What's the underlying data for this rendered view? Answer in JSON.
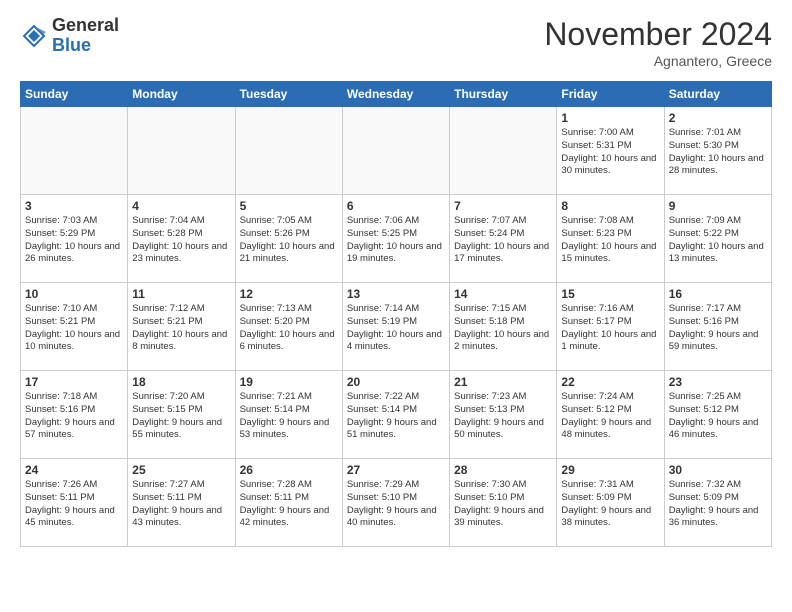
{
  "header": {
    "logo_line1": "General",
    "logo_line2": "Blue",
    "month": "November 2024",
    "location": "Agnantero, Greece"
  },
  "weekdays": [
    "Sunday",
    "Monday",
    "Tuesday",
    "Wednesday",
    "Thursday",
    "Friday",
    "Saturday"
  ],
  "weeks": [
    [
      {
        "day": "",
        "detail": ""
      },
      {
        "day": "",
        "detail": ""
      },
      {
        "day": "",
        "detail": ""
      },
      {
        "day": "",
        "detail": ""
      },
      {
        "day": "",
        "detail": ""
      },
      {
        "day": "1",
        "detail": "Sunrise: 7:00 AM\nSunset: 5:31 PM\nDaylight: 10 hours\nand 30 minutes."
      },
      {
        "day": "2",
        "detail": "Sunrise: 7:01 AM\nSunset: 5:30 PM\nDaylight: 10 hours\nand 28 minutes."
      }
    ],
    [
      {
        "day": "3",
        "detail": "Sunrise: 7:03 AM\nSunset: 5:29 PM\nDaylight: 10 hours\nand 26 minutes."
      },
      {
        "day": "4",
        "detail": "Sunrise: 7:04 AM\nSunset: 5:28 PM\nDaylight: 10 hours\nand 23 minutes."
      },
      {
        "day": "5",
        "detail": "Sunrise: 7:05 AM\nSunset: 5:26 PM\nDaylight: 10 hours\nand 21 minutes."
      },
      {
        "day": "6",
        "detail": "Sunrise: 7:06 AM\nSunset: 5:25 PM\nDaylight: 10 hours\nand 19 minutes."
      },
      {
        "day": "7",
        "detail": "Sunrise: 7:07 AM\nSunset: 5:24 PM\nDaylight: 10 hours\nand 17 minutes."
      },
      {
        "day": "8",
        "detail": "Sunrise: 7:08 AM\nSunset: 5:23 PM\nDaylight: 10 hours\nand 15 minutes."
      },
      {
        "day": "9",
        "detail": "Sunrise: 7:09 AM\nSunset: 5:22 PM\nDaylight: 10 hours\nand 13 minutes."
      }
    ],
    [
      {
        "day": "10",
        "detail": "Sunrise: 7:10 AM\nSunset: 5:21 PM\nDaylight: 10 hours\nand 10 minutes."
      },
      {
        "day": "11",
        "detail": "Sunrise: 7:12 AM\nSunset: 5:21 PM\nDaylight: 10 hours\nand 8 minutes."
      },
      {
        "day": "12",
        "detail": "Sunrise: 7:13 AM\nSunset: 5:20 PM\nDaylight: 10 hours\nand 6 minutes."
      },
      {
        "day": "13",
        "detail": "Sunrise: 7:14 AM\nSunset: 5:19 PM\nDaylight: 10 hours\nand 4 minutes."
      },
      {
        "day": "14",
        "detail": "Sunrise: 7:15 AM\nSunset: 5:18 PM\nDaylight: 10 hours\nand 2 minutes."
      },
      {
        "day": "15",
        "detail": "Sunrise: 7:16 AM\nSunset: 5:17 PM\nDaylight: 10 hours\nand 1 minute."
      },
      {
        "day": "16",
        "detail": "Sunrise: 7:17 AM\nSunset: 5:16 PM\nDaylight: 9 hours\nand 59 minutes."
      }
    ],
    [
      {
        "day": "17",
        "detail": "Sunrise: 7:18 AM\nSunset: 5:16 PM\nDaylight: 9 hours\nand 57 minutes."
      },
      {
        "day": "18",
        "detail": "Sunrise: 7:20 AM\nSunset: 5:15 PM\nDaylight: 9 hours\nand 55 minutes."
      },
      {
        "day": "19",
        "detail": "Sunrise: 7:21 AM\nSunset: 5:14 PM\nDaylight: 9 hours\nand 53 minutes."
      },
      {
        "day": "20",
        "detail": "Sunrise: 7:22 AM\nSunset: 5:14 PM\nDaylight: 9 hours\nand 51 minutes."
      },
      {
        "day": "21",
        "detail": "Sunrise: 7:23 AM\nSunset: 5:13 PM\nDaylight: 9 hours\nand 50 minutes."
      },
      {
        "day": "22",
        "detail": "Sunrise: 7:24 AM\nSunset: 5:12 PM\nDaylight: 9 hours\nand 48 minutes."
      },
      {
        "day": "23",
        "detail": "Sunrise: 7:25 AM\nSunset: 5:12 PM\nDaylight: 9 hours\nand 46 minutes."
      }
    ],
    [
      {
        "day": "24",
        "detail": "Sunrise: 7:26 AM\nSunset: 5:11 PM\nDaylight: 9 hours\nand 45 minutes."
      },
      {
        "day": "25",
        "detail": "Sunrise: 7:27 AM\nSunset: 5:11 PM\nDaylight: 9 hours\nand 43 minutes."
      },
      {
        "day": "26",
        "detail": "Sunrise: 7:28 AM\nSunset: 5:11 PM\nDaylight: 9 hours\nand 42 minutes."
      },
      {
        "day": "27",
        "detail": "Sunrise: 7:29 AM\nSunset: 5:10 PM\nDaylight: 9 hours\nand 40 minutes."
      },
      {
        "day": "28",
        "detail": "Sunrise: 7:30 AM\nSunset: 5:10 PM\nDaylight: 9 hours\nand 39 minutes."
      },
      {
        "day": "29",
        "detail": "Sunrise: 7:31 AM\nSunset: 5:09 PM\nDaylight: 9 hours\nand 38 minutes."
      },
      {
        "day": "30",
        "detail": "Sunrise: 7:32 AM\nSunset: 5:09 PM\nDaylight: 9 hours\nand 36 minutes."
      }
    ]
  ]
}
